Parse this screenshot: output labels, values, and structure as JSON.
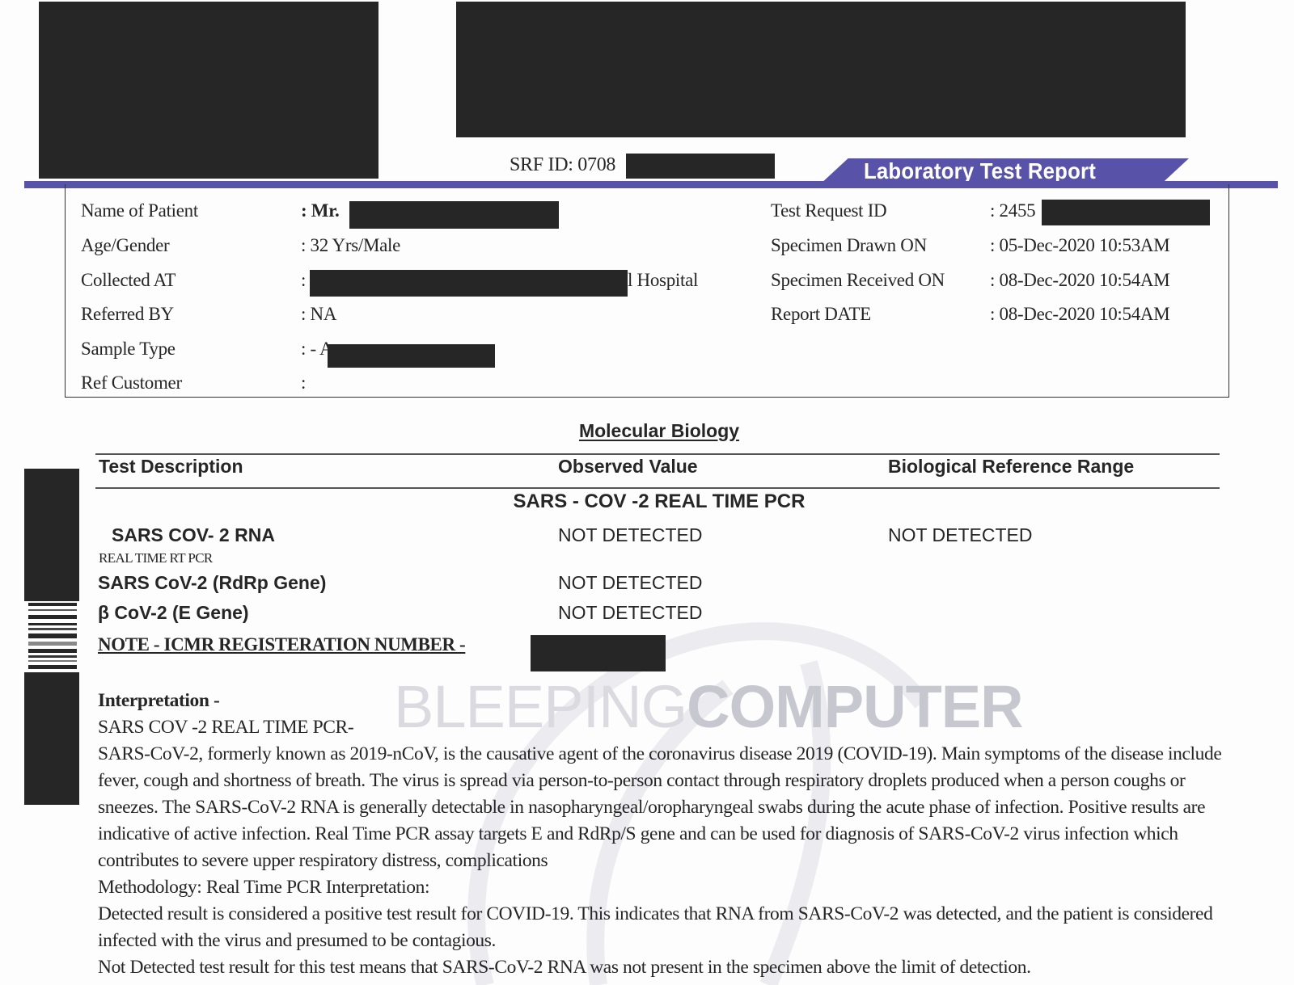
{
  "header": {
    "srf_id_label": "SRF ID: 0708",
    "banner_title": "Laboratory Test Report",
    "brand_color": "#5853a8"
  },
  "patient_info": {
    "left": [
      {
        "label": "Name of Patient",
        "value": ": Mr.",
        "redacted": true
      },
      {
        "label": "Age/Gender",
        "value": ": 32 Yrs/Male"
      },
      {
        "label": "Collected AT",
        "value": ":",
        "suffix": "l Hospital",
        "redacted": true
      },
      {
        "label": "Referred BY",
        "value": ": NA"
      },
      {
        "label": "Sample Type",
        "value": ": - A",
        "redacted": true
      },
      {
        "label": "Ref Customer",
        "value": ":"
      }
    ],
    "right": [
      {
        "label": "Test Request ID",
        "value": ": 2455",
        "redacted": true
      },
      {
        "label": "Specimen Drawn ON",
        "value": ": 05-Dec-2020 10:53AM"
      },
      {
        "label": "Specimen Received ON",
        "value": ": 08-Dec-2020 10:54AM"
      },
      {
        "label": "Report DATE",
        "value": ": 08-Dec-2020 10:54AM"
      }
    ]
  },
  "results": {
    "section_title": "Molecular Biology",
    "columns": [
      "Test Description",
      "Observed Value",
      "Biological Reference Range"
    ],
    "group_title": "SARS - COV -2 REAL TIME PCR",
    "rows": [
      {
        "test": "SARS COV- 2 RNA",
        "observed": "NOT DETECTED",
        "reference": "NOT DETECTED"
      },
      {
        "test": "SARS CoV-2 (RdRp Gene)",
        "observed": "NOT DETECTED",
        "reference": ""
      },
      {
        "test": "β CoV-2 (E Gene)",
        "observed": "NOT DETECTED",
        "reference": ""
      }
    ],
    "method": "REAL TIME RT PCR",
    "note": "NOTE - ICMR REGISTERATION NUMBER -"
  },
  "interpretation": {
    "heading": "Interpretation -",
    "subheading": "SARS COV -2 REAL TIME PCR-",
    "paragraph": "SARS-CoV-2, formerly known as 2019-nCoV, is the causative agent of the coronavirus disease 2019 (COVID-19). Main symptoms of the disease include fever, cough and shortness of breath. The virus is spread via person-to-person contact through respiratory droplets produced when a person coughs or sneezes. The SARS-CoV-2 RNA is generally detectable in nasopharyngeal/oropharyngeal swabs during the acute phase of infection. Positive results are indicative of active infection. Real Time PCR assay targets E and RdRp/S gene and can be used for diagnosis of SARS-CoV-2 virus infection which contributes to severe upper respiratory distress, complications",
    "methodology": "Methodology: Real Time PCR Interpretation:",
    "detected": "Detected result is considered a positive test result for COVID-19. This indicates that RNA from SARS-CoV-2 was detected, and the patient is considered infected with the virus and presumed to be contagious.",
    "not_detected": "Not Detected test result for this test means that SARS-CoV-2 RNA was not present in the specimen above the limit of detection."
  },
  "watermark": {
    "light": "BLEEPING",
    "bold": "COMPUTER"
  }
}
